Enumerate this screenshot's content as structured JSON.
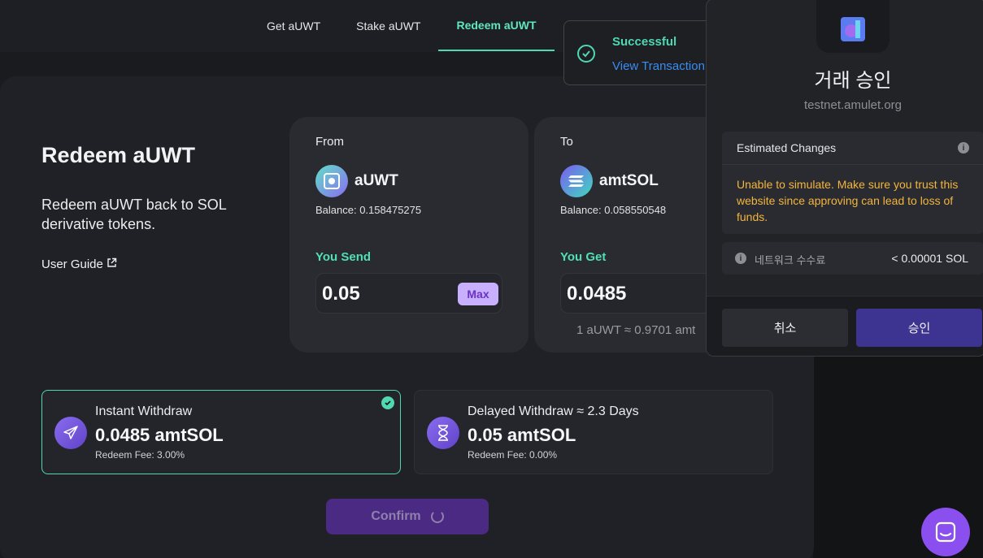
{
  "nav": {
    "tabs": [
      {
        "label": "Get aUWT"
      },
      {
        "label": "Stake aUWT"
      },
      {
        "label": "Redeem aUWT",
        "active": true
      }
    ]
  },
  "hero": {
    "title": "Redeem aUWT",
    "subtitle": "Redeem aUWT back to SOL derivative tokens.",
    "guide_label": "User Guide"
  },
  "from": {
    "label": "From",
    "token": "aUWT",
    "balance": "Balance: 0.158475275",
    "send_label": "You Send",
    "amount": "0.05",
    "max_label": "Max"
  },
  "to": {
    "label": "To",
    "token": "amtSOL",
    "balance": "Balance: 0.058550548",
    "get_label": "You Get",
    "amount": "0.0485",
    "rate": "1 aUWT ≈ 0.9701 amt"
  },
  "withdraw": {
    "instant": {
      "title": "Instant Withdraw",
      "amount": "0.0485 amtSOL",
      "fee": "Redeem Fee: 3.00%"
    },
    "delayed": {
      "title": "Delayed Withdraw ≈ 2.3 Days",
      "amount": "0.05 amtSOL",
      "fee": "Redeem Fee: 0.00%"
    }
  },
  "confirm_label": "Confirm",
  "toast": {
    "title": "Successful",
    "link": "View Transaction"
  },
  "wallet": {
    "heading": "거래 승인",
    "site": "testnet.amulet.org",
    "estimated_title": "Estimated Changes",
    "warning": "Unable to simulate. Make sure you trust this website since approving can lead to loss of funds.",
    "fee_label": "네트워크 수수료",
    "fee_value": "< 0.00001 SOL",
    "cancel_label": "취소",
    "approve_label": "승인"
  },
  "colors": {
    "accent": "#4fd8b2",
    "purple": "#8b4ff0",
    "warning": "#f2b53e",
    "link": "#3b8cf0"
  }
}
